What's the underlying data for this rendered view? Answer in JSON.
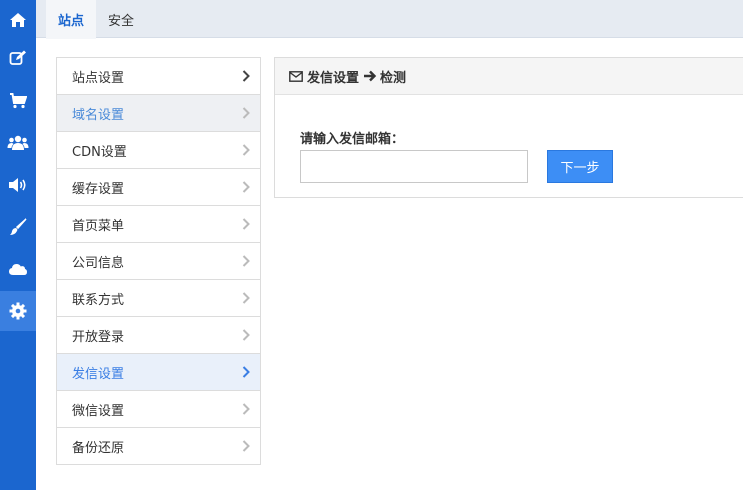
{
  "rail": {
    "items": [
      {
        "icon": "home-icon"
      },
      {
        "icon": "edit-icon"
      },
      {
        "icon": "cart-icon"
      },
      {
        "icon": "users-icon"
      },
      {
        "icon": "volume-icon"
      },
      {
        "icon": "brush-icon"
      },
      {
        "icon": "cloud-icon"
      },
      {
        "icon": "gear-icon",
        "active": true
      }
    ],
    "color": "#1b66cf",
    "active_color": "#3a7fe0"
  },
  "tabs": [
    {
      "label": "站点",
      "active": true
    },
    {
      "label": "安全",
      "active": false
    }
  ],
  "menu": {
    "items": [
      {
        "label": "站点设置",
        "state": "normal"
      },
      {
        "label": "域名设置",
        "state": "hover"
      },
      {
        "label": "CDN设置",
        "state": "normal"
      },
      {
        "label": "缓存设置",
        "state": "normal"
      },
      {
        "label": "首页菜单",
        "state": "normal"
      },
      {
        "label": "公司信息",
        "state": "normal"
      },
      {
        "label": "联系方式",
        "state": "normal"
      },
      {
        "label": "开放登录",
        "state": "normal"
      },
      {
        "label": "发信设置",
        "state": "selected"
      },
      {
        "label": "微信设置",
        "state": "normal"
      },
      {
        "label": "备份还原",
        "state": "normal"
      }
    ]
  },
  "panel": {
    "title_part1": "发信设置",
    "title_part2": "检测",
    "field_label": "请输入发信邮箱：",
    "email_value": "",
    "next_label": "下一步",
    "button_color": "#3d8ef5"
  }
}
